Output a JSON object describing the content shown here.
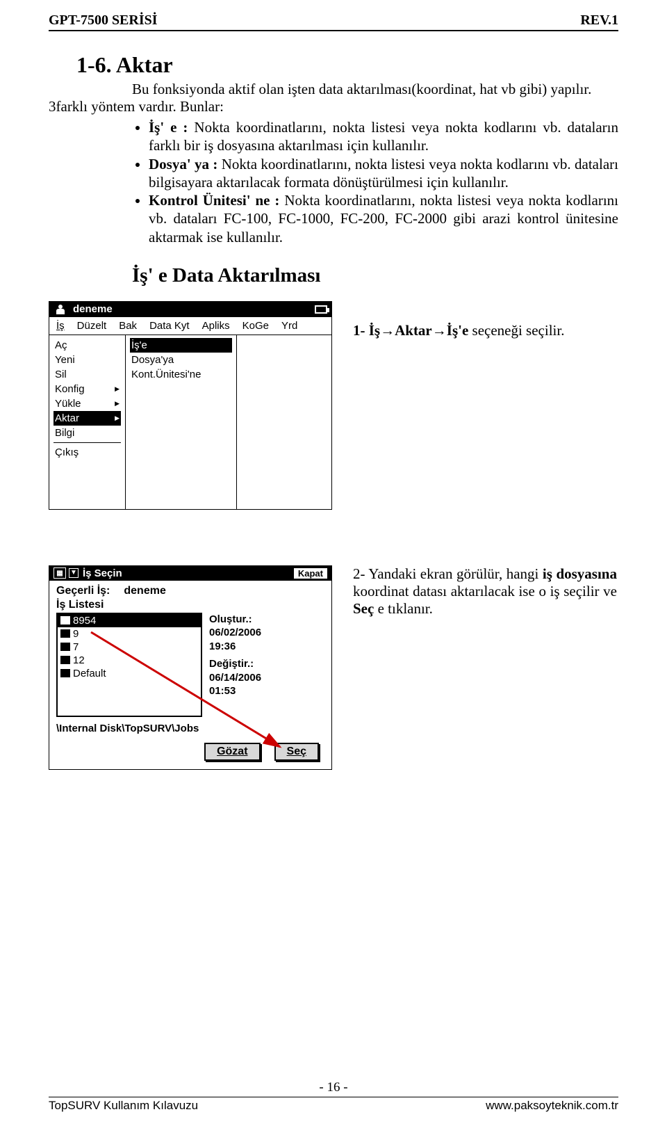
{
  "header": {
    "series": "GPT-7500 SERİSİ",
    "rev": "REV.1"
  },
  "section": {
    "title": "1-6. Aktar",
    "intro_indent": "Bu fonksiyonda aktif olan işten data aktarılması(koordinat, hat vb gibi) yapılır.",
    "intro_left": "3farklı yöntem vardır. Bunlar:",
    "bullets": [
      {
        "lead": "İş' e  : ",
        "body": "Nokta koordinatlarını, nokta listesi veya nokta kodlarını vb. dataların farklı bir iş dosyasına aktarılması için kullanılır."
      },
      {
        "lead": "Dosya' ya : ",
        "body": "Nokta koordinatlarını, nokta listesi veya nokta kodlarını vb. dataları bilgisayara aktarılacak formata dönüştürülmesi için kullanılır."
      },
      {
        "lead": "Kontrol Ünitesi' ne : ",
        "body": "Nokta koordinatlarını, nokta listesi veya nokta kodlarını vb. dataları FC-100, FC-1000, FC-200, FC-2000 gibi arazi kontrol ünitesine aktarmak ise kullanılır."
      }
    ],
    "subhead": "İş' e Data Aktarılması"
  },
  "step1": {
    "caption_prefix": "1- İş",
    "arrow": "→",
    "caption_mid1": "Aktar",
    "caption_mid2": "İş'e",
    "caption_suffix": " seçeneği seçilir."
  },
  "dev1": {
    "title": "deneme",
    "menubar": [
      "İş",
      "Düzelt",
      "Bak",
      "Data Kyt",
      "Apliks",
      "KoGe",
      "Yrd"
    ],
    "left_menu": [
      {
        "label": "Aç",
        "ul": "A",
        "sel": false,
        "arrow": false
      },
      {
        "label": "Yeni",
        "ul": "Y",
        "sel": false,
        "arrow": false
      },
      {
        "label": "Sil",
        "ul": "S",
        "sel": false,
        "arrow": false
      },
      {
        "label": "Konfig",
        "ul": "K",
        "sel": false,
        "arrow": true
      },
      {
        "label": "Yükle",
        "ul": "Y",
        "sel": false,
        "arrow": true
      },
      {
        "label": "Aktar",
        "ul": "A",
        "sel": true,
        "arrow": true
      },
      {
        "label": "Bilgi",
        "ul": "B",
        "sel": false,
        "arrow": false
      },
      {
        "label": "hr",
        "ul": "",
        "sel": false,
        "arrow": false
      },
      {
        "label": "Çıkış",
        "ul": "Ç",
        "sel": false,
        "arrow": false
      }
    ],
    "right_menu": [
      {
        "label": "İş'e",
        "sel": true
      },
      {
        "label": "Dosya'ya",
        "sel": false
      },
      {
        "label": "Kont.Ünitesi'ne",
        "sel": false
      }
    ]
  },
  "step2": {
    "text_parts": [
      "2-   Yandaki  ekran  görülür,  hangi ",
      " dosyasına",
      "        koordinat        datası aktarılacak  ise  o  iş  seçilir  ve ",
      "  e tıklanır."
    ],
    "bold1": "iş",
    "bold2": "Seç"
  },
  "dev2": {
    "title": "İş Seçin",
    "close": "Kapat",
    "label_current": "Geçerli İş:",
    "current_job": "deneme",
    "group_title": "İş Listesi",
    "list": [
      {
        "label": "8954",
        "sel": true
      },
      {
        "label": "9",
        "sel": false
      },
      {
        "label": "7",
        "sel": false
      },
      {
        "label": "12",
        "sel": false
      },
      {
        "label": "Default",
        "sel": false
      }
    ],
    "details": [
      "Oluştur.:",
      "06/02/2006",
      "19:36",
      "Değiştir.:",
      "06/14/2006",
      "01:53"
    ],
    "path": "\\Internal Disk\\TopSURV\\Jobs",
    "btn_browse": "Gözat",
    "btn_select": "Seç"
  },
  "footer": {
    "pageno": "- 16 -",
    "left": "TopSURV Kullanım Kılavuzu",
    "right": "www.paksoyteknik.com.tr"
  }
}
